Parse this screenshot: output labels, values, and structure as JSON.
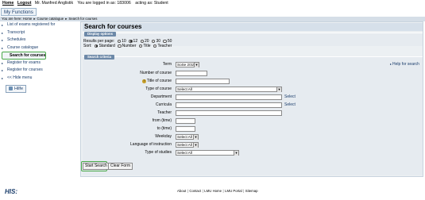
{
  "topbar": {
    "home": "Home",
    "logout": "Logout",
    "user": "Mr. Manfred Anglistik",
    "login_info": "You are logged in as: 183006",
    "role": "acting as: Student"
  },
  "my_functions": "My Functions",
  "breadcrumb": {
    "prefix": "You are here:",
    "items": [
      "Home",
      "Course catalogue",
      "Search for courses"
    ]
  },
  "sidebar": {
    "items": [
      {
        "label": "List of exams registered for"
      },
      {
        "label": "Transcript"
      },
      {
        "label": "Schedules"
      },
      {
        "label": "Course catalogue"
      },
      {
        "label": "Search for courses"
      },
      {
        "label": "Register for exams"
      },
      {
        "label": "Register for courses"
      },
      {
        "label": "<< Hide menu"
      }
    ],
    "help": "Hilfe"
  },
  "main": {
    "title": "Search for courses",
    "display_options": {
      "tab": "Display options",
      "results_label": "Results per page:",
      "results": [
        "10",
        "12",
        "20",
        "30",
        "50"
      ],
      "results_selected": "12",
      "sort_label": "Sort:",
      "sort": [
        "Standard",
        "Number",
        "Title",
        "Teacher"
      ],
      "sort_selected": "Standard"
    },
    "search_criteria": {
      "tab": "Search criteria",
      "help": "Help for search",
      "term_label": "Term",
      "term_value": "SoSe 2015",
      "number_label": "Number of course",
      "title_label": "Title of course",
      "type_label": "Type of course",
      "type_value": "Select All",
      "department_label": "Department",
      "curricula_label": "Curricula",
      "select_label": "Select",
      "teacher_label": "Teacher",
      "from_label": "from (time)",
      "to_label": "to (time)",
      "weekday_label": "Weekday",
      "weekday_value": "Select All",
      "language_label": "Language of instruction",
      "language_value": "Select All",
      "studies_label": "Type of studies",
      "studies_value": "Select All"
    },
    "buttons": {
      "start": "Start Search",
      "clear": "Clear Form"
    }
  },
  "footer": {
    "logo": "HIS:",
    "links": [
      "About",
      "Contact",
      "LMU Home",
      "LMU Portal",
      "Sitemap"
    ]
  }
}
